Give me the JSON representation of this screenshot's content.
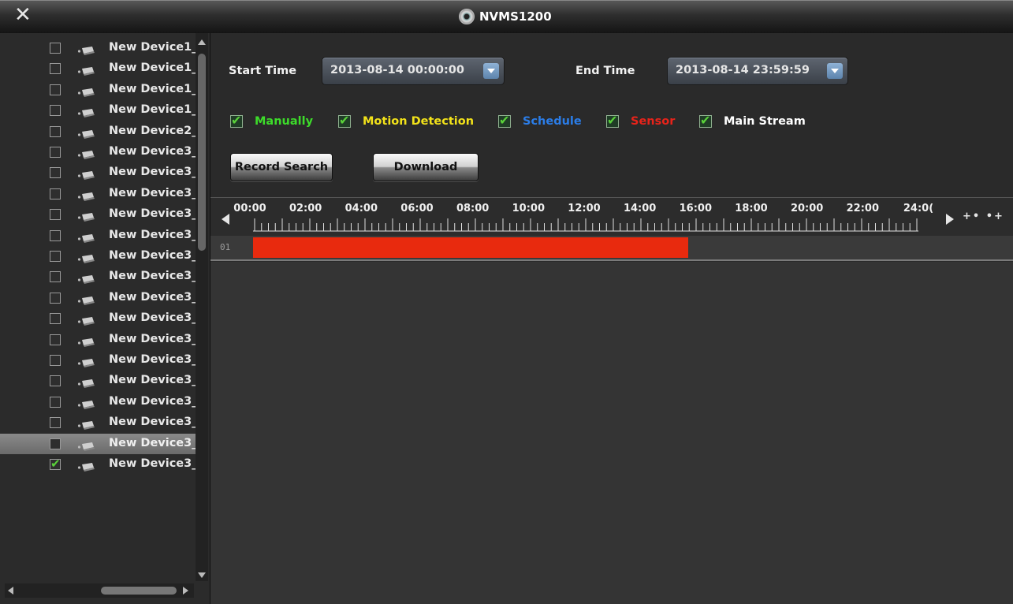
{
  "window": {
    "title": "NVMS1200",
    "close_glyph": "✕"
  },
  "sidebar": {
    "devices": [
      {
        "name": "New Device1_",
        "checked": false
      },
      {
        "name": "New Device1_",
        "checked": false
      },
      {
        "name": "New Device1_",
        "checked": false
      },
      {
        "name": "New Device1_",
        "checked": false
      },
      {
        "name": "New Device2_",
        "checked": false
      },
      {
        "name": "New Device3_",
        "checked": false
      },
      {
        "name": "New Device3_",
        "checked": false
      },
      {
        "name": "New Device3_",
        "checked": false
      },
      {
        "name": "New Device3_",
        "checked": false
      },
      {
        "name": "New Device3_",
        "checked": false
      },
      {
        "name": "New Device3_",
        "checked": false
      },
      {
        "name": "New Device3_",
        "checked": false
      },
      {
        "name": "New Device3_",
        "checked": false
      },
      {
        "name": "New Device3_",
        "checked": false
      },
      {
        "name": "New Device3_",
        "checked": false
      },
      {
        "name": "New Device3_",
        "checked": false
      },
      {
        "name": "New Device3_",
        "checked": false
      },
      {
        "name": "New Device3_",
        "checked": false
      },
      {
        "name": "New Device3_",
        "checked": false
      },
      {
        "name": "New Device3_",
        "checked": false,
        "highlighted": true
      },
      {
        "name": "New Device3_",
        "checked": true
      }
    ]
  },
  "search": {
    "start_label": "Start Time",
    "start_value": "2013-08-14 00:00:00",
    "end_label": "End Time",
    "end_value": "2013-08-14 23:59:59"
  },
  "filters": {
    "manually": {
      "label": "Manually",
      "color": "#3ddc2a"
    },
    "motion": {
      "label": "Motion Detection",
      "color": "#f2e21a"
    },
    "schedule": {
      "label": "Schedule",
      "color": "#2b7de8"
    },
    "sensor": {
      "label": "Sensor",
      "color": "#e8231a"
    },
    "main_stream": {
      "label": "Main Stream",
      "color": "#ffffff"
    }
  },
  "buttons": {
    "record_search": "Record Search",
    "download": "Download"
  },
  "timeline": {
    "hour_labels": [
      "00:00",
      "02:00",
      "04:00",
      "06:00",
      "08:00",
      "10:00",
      "12:00",
      "14:00",
      "16:00",
      "18:00",
      "20:00",
      "22:00",
      "24:0("
    ],
    "zoom_glyph": "+• •+",
    "channels": [
      {
        "id": "01",
        "recordings": [
          {
            "start_hour": 0,
            "end_hour": 15.7,
            "color": "#e82a0e"
          }
        ]
      }
    ]
  }
}
